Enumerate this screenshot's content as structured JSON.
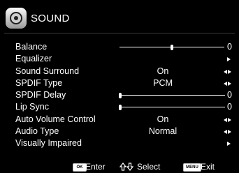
{
  "header": {
    "title": "SOUND",
    "icon": "speaker-icon"
  },
  "menu": [
    {
      "label": "Balance",
      "control": "slider",
      "number": "0",
      "level": 0.5
    },
    {
      "label": "Equalizer",
      "control": "submenu"
    },
    {
      "label": "Sound Surround",
      "control": "select",
      "value": "On"
    },
    {
      "label": "SPDIF Type",
      "control": "select",
      "value": "PCM"
    },
    {
      "label": "SPDIF Delay",
      "control": "slider",
      "number": "0",
      "level": 0.0
    },
    {
      "label": "Lip Sync",
      "control": "slider",
      "number": "0",
      "level": 0.0
    },
    {
      "label": "Auto Volume Control",
      "control": "select",
      "value": "On"
    },
    {
      "label": "Audio Type",
      "control": "select",
      "value": "Normal"
    },
    {
      "label": "Visually Impaired",
      "control": "submenu"
    }
  ],
  "footer": {
    "ok_key": "OK",
    "enter_label": "Enter",
    "select_label": "Select",
    "menu_key": "MENU",
    "exit_label": "Exit"
  }
}
